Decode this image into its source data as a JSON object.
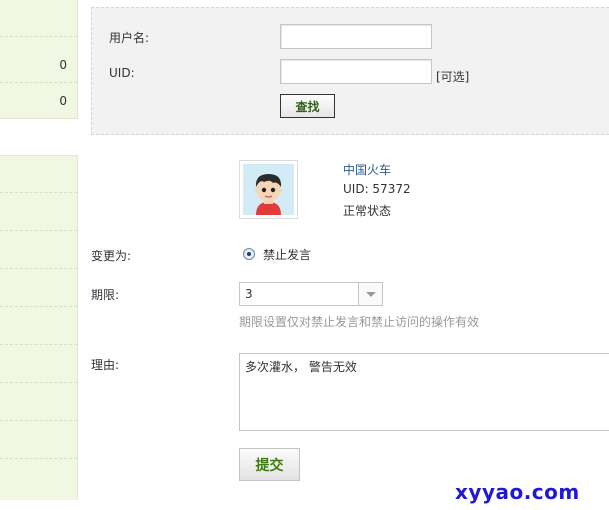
{
  "sidebar_top": {
    "counts": [
      "0",
      "0"
    ]
  },
  "search": {
    "username_label": "用户名:",
    "username_value": "",
    "uid_label": "UID:",
    "uid_value": "",
    "uid_optional": "[可选]",
    "search_button": "查找"
  },
  "user": {
    "name": "中国火车",
    "uid": "UID: 57372",
    "status": "正常状态"
  },
  "form": {
    "change_label": "变更为:",
    "change_option": "禁止发言",
    "period_label": "期限:",
    "period_value": "3",
    "period_hint": "期限设置仅对禁止发言和禁止访问的操作有效",
    "reason_label": "理由:",
    "reason_value": "多次灌水， 警告无效",
    "submit_button": "提交"
  },
  "watermark": "xyyao.com",
  "colors": {
    "sidebar_bg": "#f1f7e3",
    "panel_bg": "#f2f2f2",
    "link_blue": "#2a5a8a",
    "button_green": "#3d7a12",
    "watermark_blue": "#1f18d8"
  }
}
